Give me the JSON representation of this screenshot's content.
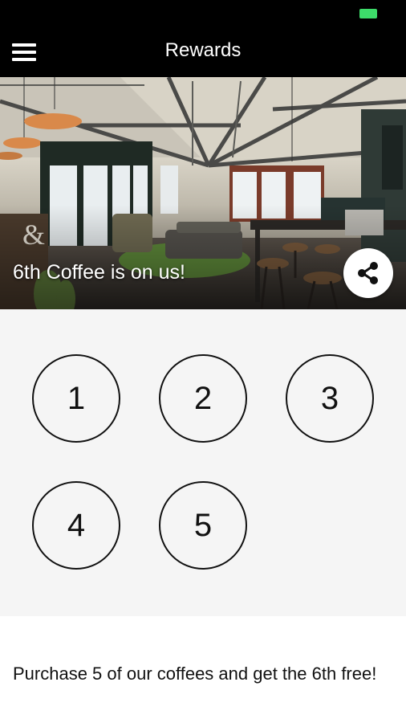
{
  "status_bar": {
    "battery_color": "#3ddc6a"
  },
  "app_bar": {
    "title": "Rewards",
    "menu_icon": "hamburger-menu-icon"
  },
  "hero": {
    "image": "cafe-interior-photo",
    "caption": "6th Coffee is on us!",
    "share_icon": "share-icon"
  },
  "stamps": [
    "1",
    "2",
    "3",
    "4",
    "5"
  ],
  "description": "Purchase 5 of our coffees and get the 6th free!"
}
